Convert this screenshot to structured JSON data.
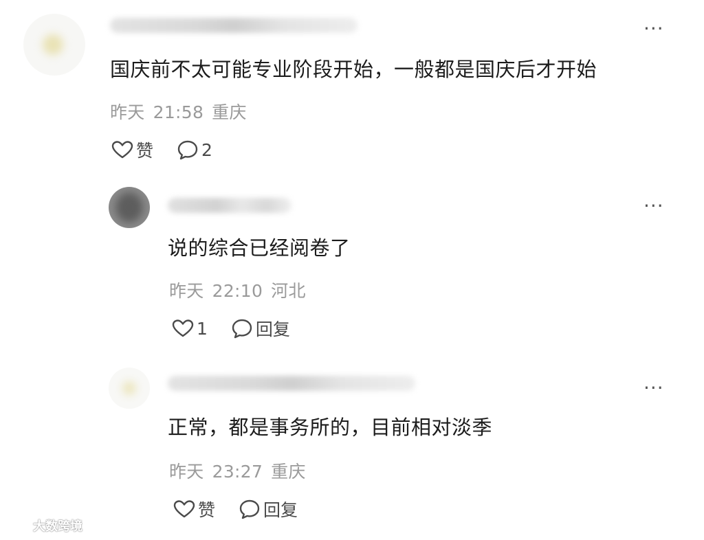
{
  "comments": [
    {
      "content": "国庆前不太可能专业阶段开始，一般都是国庆后才开始",
      "day": "昨天",
      "time": "21:58",
      "location": "重庆",
      "like_label": "赞",
      "reply_label": "2",
      "more": "···"
    },
    {
      "content": "说的综合已经阅卷了",
      "day": "昨天",
      "time": "22:10",
      "location": "河北",
      "like_label": "1",
      "reply_label": "回复",
      "more": "···"
    },
    {
      "content": "正常，都是事务所的，目前相对淡季",
      "day": "昨天",
      "time": "23:27",
      "location": "重庆",
      "like_label": "赞",
      "reply_label": "回复",
      "more": "···"
    }
  ],
  "watermark": {
    "text": "大数跨境"
  },
  "colors": {
    "text": "#1c1c1c",
    "meta": "#9a9a9a",
    "action": "#4a4a4a"
  }
}
